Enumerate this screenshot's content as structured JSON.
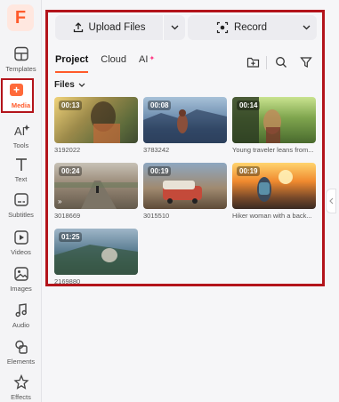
{
  "app": {
    "logo_letter": "F",
    "accent": "#ff5a2a",
    "highlight_border": "#b3141b"
  },
  "sidebar": {
    "items": [
      {
        "label": "Templates",
        "icon": "templates-icon"
      },
      {
        "label": "Media",
        "icon": "media-icon",
        "active": true
      },
      {
        "label": "Tools",
        "icon": "ai-tools-icon"
      },
      {
        "label": "Text",
        "icon": "text-icon"
      },
      {
        "label": "Subtitles",
        "icon": "subtitles-icon"
      },
      {
        "label": "Videos",
        "icon": "videos-icon"
      },
      {
        "label": "Images",
        "icon": "images-icon"
      },
      {
        "label": "Audio",
        "icon": "audio-icon"
      },
      {
        "label": "Elements",
        "icon": "elements-icon"
      },
      {
        "label": "Effects",
        "icon": "effects-icon"
      }
    ]
  },
  "toolbar": {
    "upload_label": "Upload Files",
    "record_label": "Record"
  },
  "tabs": [
    {
      "label": "Project",
      "active": true
    },
    {
      "label": "Cloud"
    },
    {
      "label": "AI"
    }
  ],
  "files_filter": {
    "label": "Files"
  },
  "media_items": [
    {
      "duration": "00:13",
      "caption": "3192022"
    },
    {
      "duration": "00:08",
      "caption": "3783242"
    },
    {
      "duration": "00:14",
      "caption": "Young traveler leans from..."
    },
    {
      "duration": "00:24",
      "caption": "3018669"
    },
    {
      "duration": "00:19",
      "caption": "3015510"
    },
    {
      "duration": "00:19",
      "caption": "Hiker woman with a back..."
    },
    {
      "duration": "01:25",
      "caption": "2169880"
    }
  ]
}
